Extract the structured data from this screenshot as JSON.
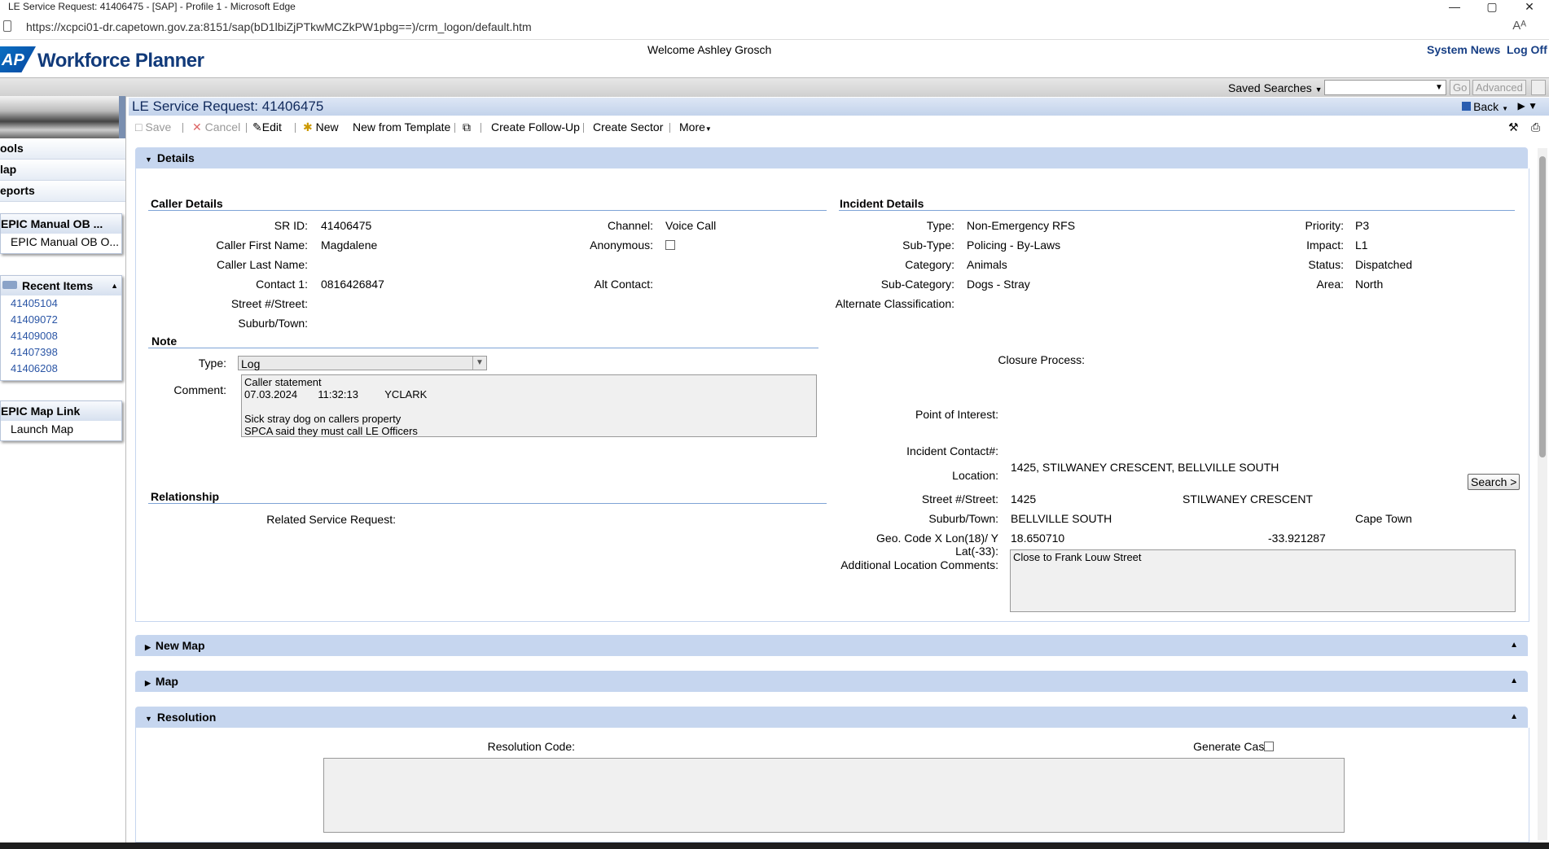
{
  "window": {
    "title": "LE Service Request: 41406475 - [SAP] - Profile 1 - Microsoft Edge",
    "url": "https://xcpci01-dr.capetown.gov.za:8151/sap(bD1lbiZjPTkwMCZkPW1pbg==)/crm_logon/default.htm",
    "reader_icon": "Aᴬ",
    "controls": {
      "minimize": "—",
      "maximize": "▢",
      "close": "✕"
    }
  },
  "header": {
    "logo": "AP",
    "app_name": "Workforce Planner",
    "welcome": "Welcome Ashley Grosch",
    "system_news": "System News",
    "log_off": "Log Off"
  },
  "searchbar": {
    "saved_searches": "Saved Searches",
    "go": "Go",
    "advanced": "Advanced"
  },
  "nav": {
    "items": [
      "ools",
      "lap",
      "eports"
    ],
    "epic_manual": {
      "title": "EPIC Manual OB ...",
      "item": "EPIC Manual OB O..."
    },
    "recent": {
      "title": "Recent Items",
      "items": [
        "41405104",
        "41409072",
        "41409008",
        "41407398",
        "41406208"
      ]
    },
    "map_link": {
      "title": "EPIC Map Link",
      "item": "Launch Map"
    }
  },
  "page": {
    "title": "LE Service Request: 41406475",
    "back": "Back"
  },
  "toolbar": {
    "save": "Save",
    "cancel": "Cancel",
    "edit": "Edit",
    "new": "New",
    "new_from_template": "New from Template",
    "create_follow_up": "Create Follow-Up",
    "create_sector": "Create Sector",
    "more": "More"
  },
  "details": {
    "section_title": "Details",
    "caller": {
      "title": "Caller Details",
      "sr_id_label": "SR ID:",
      "sr_id": "41406475",
      "channel_label": "Channel:",
      "channel": "Voice Call",
      "first_name_label": "Caller First Name:",
      "first_name": "Magdalene",
      "anonymous_label": "Anonymous:",
      "last_name_label": "Caller Last Name:",
      "contact1_label": "Contact 1:",
      "contact1": "0816426847",
      "alt_contact_label": "Alt Contact:",
      "street_label": "Street #/Street:",
      "suburb_label": "Suburb/Town:"
    },
    "note": {
      "title": "Note",
      "type_label": "Type:",
      "type": "Log",
      "comment_label": "Comment:",
      "comment": "Caller statement\n07.03.2024       11:32:13         YCLARK\n\nSick stray dog on callers property\nSPCA said they must call LE Officers"
    },
    "relationship": {
      "title": "Relationship",
      "related_label": "Related Service Request:"
    },
    "incident": {
      "title": "Incident Details",
      "type_label": "Type:",
      "type": "Non-Emergency RFS",
      "priority_label": "Priority:",
      "priority": "P3",
      "subtype_label": "Sub-Type:",
      "subtype": "Policing - By-Laws",
      "impact_label": "Impact:",
      "impact": "L1",
      "category_label": "Category:",
      "category": "Animals",
      "status_label": "Status:",
      "status": "Dispatched",
      "subcategory_label": "Sub-Category:",
      "subcategory": "Dogs - Stray",
      "area_label": "Area:",
      "area": "North",
      "alt_class_label": "Alternate Classification:",
      "closure_label": "Closure Process:",
      "poi_label": "Point of Interest:",
      "incident_contact_label": "Incident Contact#:",
      "location_label": "Location:",
      "location": "1425, STILWANEY CRESCENT, BELLVILLE SOUTH",
      "search_button": "Search >",
      "street_label": "Street #/Street:",
      "street_no": "1425",
      "street_name": "STILWANEY CRESCENT",
      "suburb_label": "Suburb/Town:",
      "suburb": "BELLVILLE SOUTH",
      "city": "Cape Town",
      "geo_label": "Geo. Code X Lon(18)/ Y Lat(-33):",
      "lon": "18.650710",
      "lat": "-33.921287",
      "add_comments_label": "Additional Location Comments:",
      "add_comments": "Close to Frank Louw Street"
    }
  },
  "sections": {
    "new_map": "New Map",
    "map": "Map",
    "resolution": "Resolution"
  },
  "resolution": {
    "code_label": "Resolution Code:",
    "generate_case_label": "Generate Case:"
  }
}
